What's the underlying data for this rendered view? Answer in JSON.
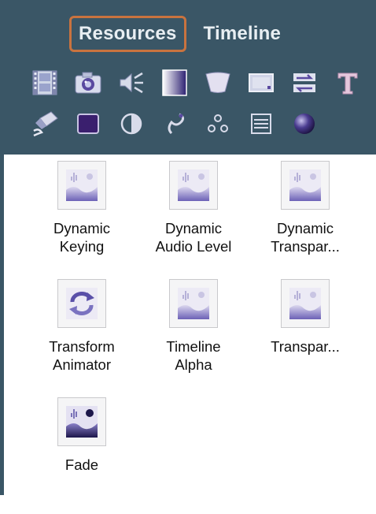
{
  "tabs": [
    {
      "label": "Resources",
      "active": true
    },
    {
      "label": "Timeline",
      "active": false
    }
  ],
  "toolbar_row1": [
    {
      "icon": "film-icon"
    },
    {
      "icon": "camera-icon"
    },
    {
      "icon": "audio-icon"
    },
    {
      "icon": "gradient-icon"
    },
    {
      "icon": "mask-shape-icon"
    },
    {
      "icon": "frame-icon"
    },
    {
      "icon": "transition-icon"
    },
    {
      "icon": "text-icon"
    }
  ],
  "toolbar_row2": [
    {
      "icon": "eraser-icon"
    },
    {
      "icon": "square-icon"
    },
    {
      "icon": "contrast-icon"
    },
    {
      "icon": "spiral-icon"
    },
    {
      "icon": "particles-icon"
    },
    {
      "icon": "lines-icon"
    },
    {
      "icon": "sphere-icon"
    }
  ],
  "items": [
    {
      "label": "Dynamic\nKeying",
      "icon": "effect-icon"
    },
    {
      "label": "Dynamic\nAudio Level",
      "icon": "effect-icon"
    },
    {
      "label": "Dynamic\nTranspar...",
      "icon": "effect-icon"
    },
    {
      "label": "Transform\nAnimator",
      "icon": "cycle-icon"
    },
    {
      "label": "Timeline\nAlpha",
      "icon": "effect-icon"
    },
    {
      "label": "Transpar...",
      "icon": "effect-icon"
    },
    {
      "label": "Fade",
      "icon": "fade-effect-icon"
    }
  ],
  "colors": {
    "header_bg": "#3a5666",
    "active_tab_border": "#c9733f",
    "icon_purple": "#5a4aa0"
  }
}
